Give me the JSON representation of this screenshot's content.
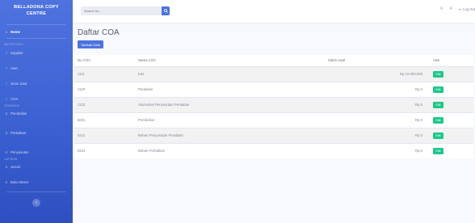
{
  "brand": {
    "line1": "BELLADONA COPY",
    "line2": "CENTRE"
  },
  "sidebar": {
    "home": "Home",
    "heading_master": "Master Data",
    "master_items": [
      "Supplier",
      "Aset",
      "Jenis Jasa",
      "COA"
    ],
    "heading_transaksi": "Transaksi",
    "transaksi_items": [
      "Pembelian",
      "Perbaikan",
      "Penyusutan"
    ],
    "heading_laporan": "Laporan",
    "laporan_items": [
      "Jurnal",
      "Buku Besar"
    ],
    "toggle": "‹"
  },
  "topbar": {
    "search_placeholder": "Search for...",
    "notif_badge": "",
    "user_label": "Log Out"
  },
  "page": {
    "title": "Daftar COA",
    "add_button": "Tambah Data"
  },
  "table": {
    "headers": [
      "No COA",
      "Nama COA",
      "Saldo Awal",
      "Aksi"
    ],
    "rows": [
      {
        "no": "1111",
        "nama": "Kas",
        "saldo": "Rp.10.000.000",
        "aksi": "Edit"
      },
      {
        "no": "1120",
        "nama": "Peralatan",
        "saldo": "Rp.0",
        "aksi": "Edit"
      },
      {
        "no": "1122",
        "nama": "Akumulasi Penyusutan Peralatan",
        "saldo": "Rp.0",
        "aksi": "Edit"
      },
      {
        "no": "5001",
        "nama": "Pembelian",
        "saldo": "Rp.0",
        "aksi": "Edit"
      },
      {
        "no": "5211",
        "nama": "Beban Penyusutan Peralatan",
        "saldo": "Rp.0",
        "aksi": "Edit"
      },
      {
        "no": "5224",
        "nama": "Beban Perbaikan",
        "saldo": "Rp.0",
        "aksi": "Edit"
      }
    ]
  },
  "colors": {
    "primary": "#4e73df",
    "success": "#1cc88a",
    "danger": "#e74a3b"
  },
  "icons": {
    "home": "home-icon",
    "nav": "wrench-icon",
    "transaksi": "list-icon",
    "search": "search-icon",
    "bell": "bell-icon",
    "mail": "envelope-icon"
  }
}
